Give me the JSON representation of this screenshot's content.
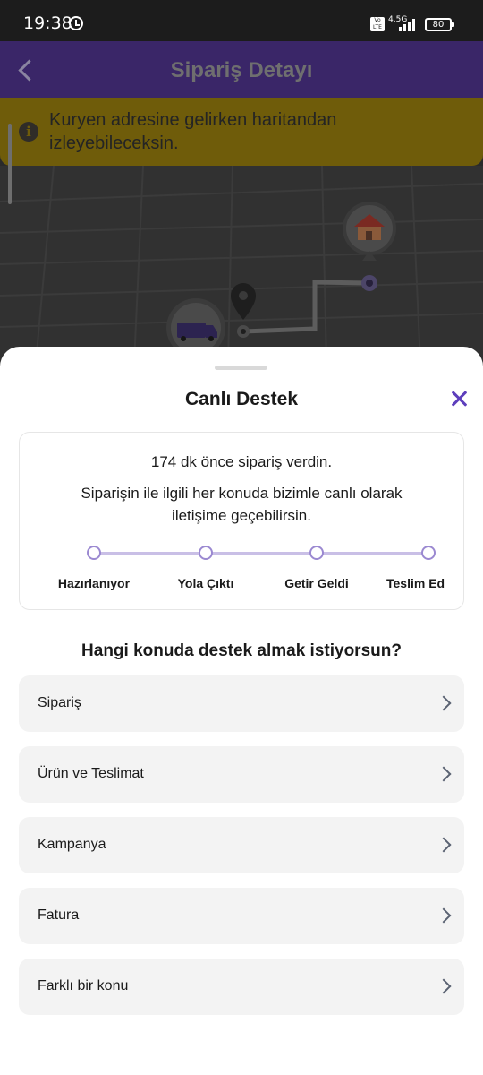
{
  "status_bar": {
    "time": "19:38",
    "network": "4.5G",
    "volte": "Vo LTE",
    "battery": "80"
  },
  "header": {
    "title": "Sipariş Detayı"
  },
  "info_banner": {
    "text": "Kuryen adresine gelirken haritandan izleyebileceksin."
  },
  "map": {
    "icons": [
      "house-icon",
      "location-pin-icon",
      "delivery-van-icon"
    ]
  },
  "sheet": {
    "title": "Canlı Destek",
    "order_card": {
      "time_text": "174 dk önce sipariş verdin.",
      "support_text": "Siparişin ile ilgili her konuda bizimle canlı olarak iletişime geçebilirsin.",
      "steps": [
        "Hazırlanıyor",
        "Yola Çıktı",
        "Getir Geldi",
        "Teslim Ed"
      ]
    },
    "question": "Hangi konuda destek almak istiyorsun?",
    "topics": [
      "Sipariş",
      "Ürün ve Teslimat",
      "Kampanya",
      "Fatura",
      "Farklı bir konu"
    ]
  },
  "colors": {
    "header": "#3a2668",
    "accent": "#5d3ebc",
    "banner": "#6f5c0a",
    "progress": "#c9bfe6"
  }
}
